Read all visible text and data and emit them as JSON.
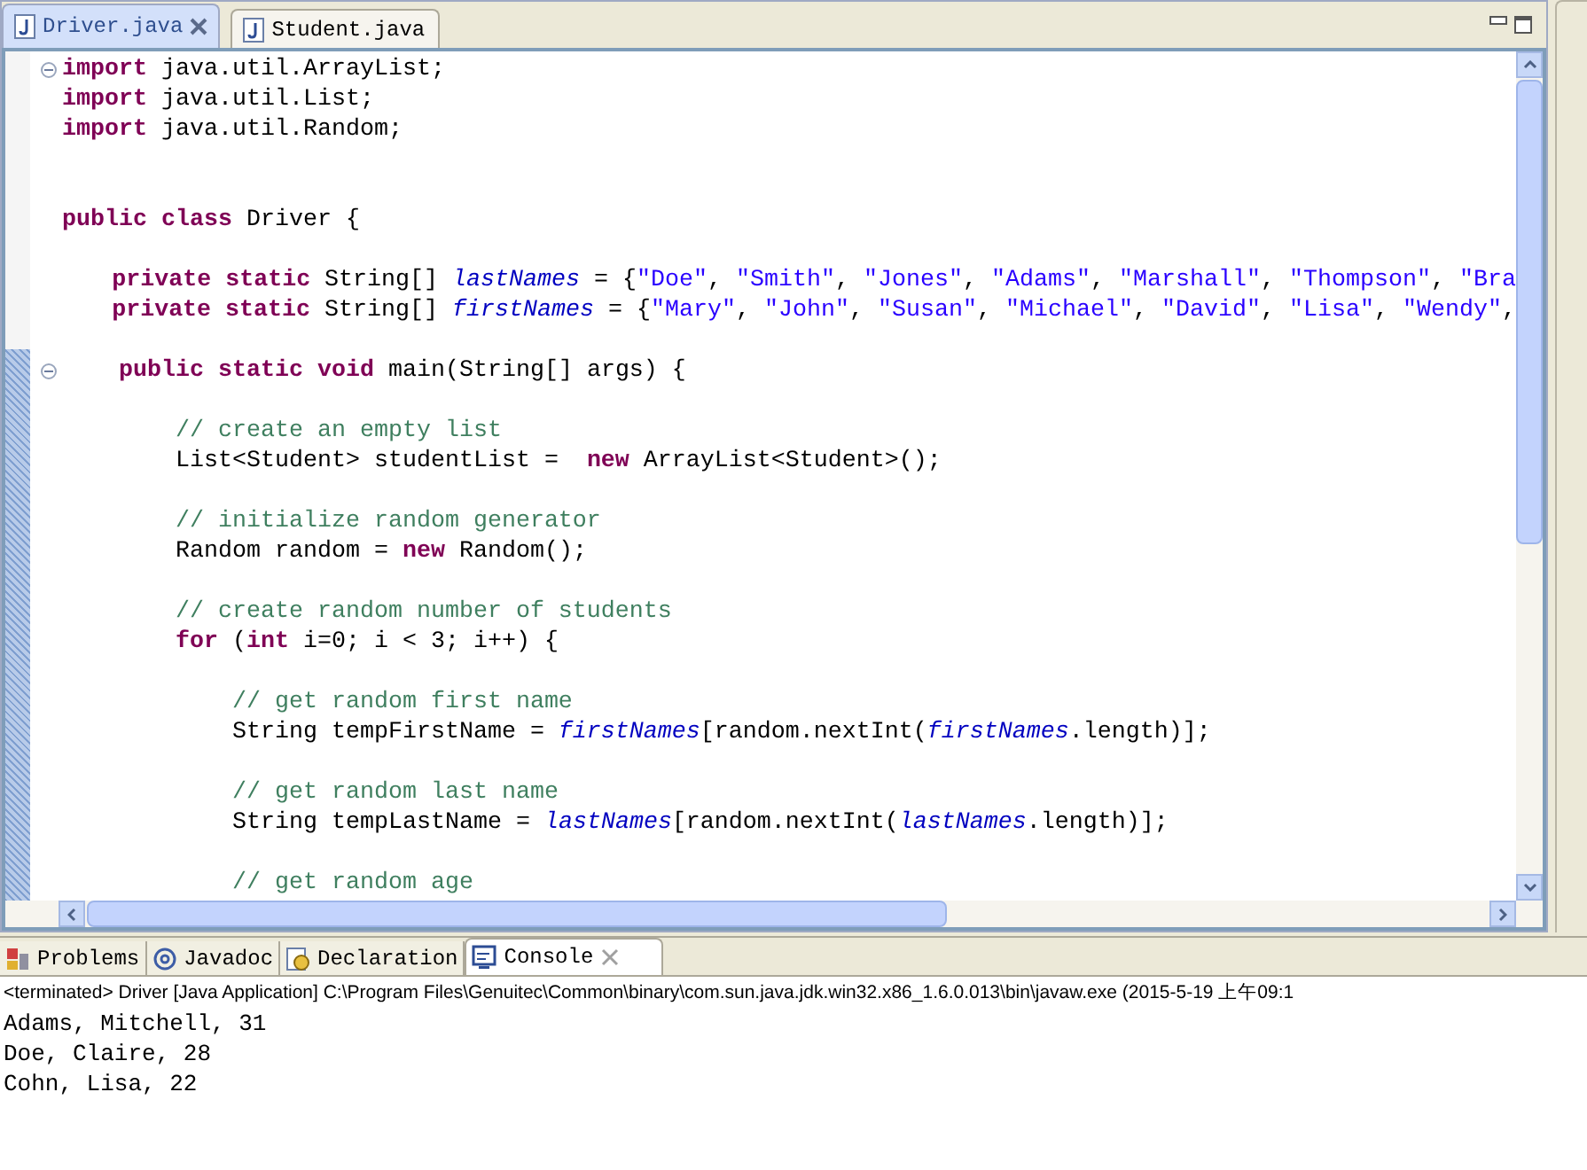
{
  "editor_tabs": [
    {
      "label": "Driver.java",
      "selected": true,
      "closable": true
    },
    {
      "label": "Student.java",
      "selected": false,
      "closable": false
    }
  ],
  "code_lines": [
    {
      "fold": true,
      "tokens": [
        {
          "kind": "keyword",
          "text": "import"
        },
        {
          "kind": "plain",
          "text": " java.util.ArrayList;"
        }
      ]
    },
    {
      "fold": false,
      "tokens": [
        {
          "kind": "keyword",
          "text": "import"
        },
        {
          "kind": "plain",
          "text": " java.util.List;"
        }
      ]
    },
    {
      "fold": false,
      "tokens": [
        {
          "kind": "keyword",
          "text": "import"
        },
        {
          "kind": "plain",
          "text": " java.util.Random;"
        }
      ]
    },
    {
      "fold": false
    },
    {
      "fold": false
    },
    {
      "fold": false,
      "tokens": [
        {
          "kind": "keyword",
          "text": "public class"
        },
        {
          "kind": "plain",
          "text": " Driver {"
        }
      ]
    },
    {
      "fold": false
    },
    {
      "fold": false,
      "tokens": [
        {
          "kind": "keyword",
          "text": "    private static"
        },
        {
          "kind": "plain",
          "text": " String[] "
        },
        {
          "kind": "field",
          "text": "lastNames"
        },
        {
          "kind": "plain",
          "text": " = {"
        },
        {
          "kind": "string",
          "text": "\"Doe\""
        },
        {
          "kind": "plain",
          "text": ", "
        },
        {
          "kind": "string",
          "text": "\"Smith\""
        },
        {
          "kind": "plain",
          "text": ", "
        },
        {
          "kind": "string",
          "text": "\"Jones\""
        },
        {
          "kind": "plain",
          "text": ", "
        },
        {
          "kind": "string",
          "text": "\"Adams\""
        },
        {
          "kind": "plain",
          "text": ", "
        },
        {
          "kind": "string",
          "text": "\"Marshall\""
        },
        {
          "kind": "plain",
          "text": ", "
        },
        {
          "kind": "string",
          "text": "\"Thompson\""
        },
        {
          "kind": "plain",
          "text": ", "
        },
        {
          "kind": "string",
          "text": "\"Bra"
        }
      ]
    },
    {
      "fold": false,
      "tokens": [
        {
          "kind": "keyword",
          "text": "    private static"
        },
        {
          "kind": "plain",
          "text": " String[] "
        },
        {
          "kind": "field",
          "text": "firstNames"
        },
        {
          "kind": "plain",
          "text": " = {"
        },
        {
          "kind": "string",
          "text": "\"Mary\""
        },
        {
          "kind": "plain",
          "text": ", "
        },
        {
          "kind": "string",
          "text": "\"John\""
        },
        {
          "kind": "plain",
          "text": ", "
        },
        {
          "kind": "string",
          "text": "\"Susan\""
        },
        {
          "kind": "plain",
          "text": ", "
        },
        {
          "kind": "string",
          "text": "\"Michael\""
        },
        {
          "kind": "plain",
          "text": ", "
        },
        {
          "kind": "string",
          "text": "\"David\""
        },
        {
          "kind": "plain",
          "text": ", "
        },
        {
          "kind": "string",
          "text": "\"Lisa\""
        },
        {
          "kind": "plain",
          "text": ", "
        },
        {
          "kind": "string",
          "text": "\"Wendy\""
        },
        {
          "kind": "plain",
          "text": ","
        }
      ]
    },
    {
      "fold": false
    },
    {
      "fold": true,
      "tokens": [
        {
          "kind": "keyword",
          "text": "    public static void"
        },
        {
          "kind": "plain",
          "text": " main(String[] args) {"
        }
      ]
    },
    {
      "fold": false
    },
    {
      "fold": false,
      "tokens": [
        {
          "kind": "comment",
          "text": "        // create an empty list"
        }
      ]
    },
    {
      "fold": false,
      "tokens": [
        {
          "kind": "plain",
          "text": "        List<Student> studentList =  "
        },
        {
          "kind": "keyword",
          "text": "new"
        },
        {
          "kind": "plain",
          "text": " ArrayList<Student>();"
        }
      ]
    },
    {
      "fold": false
    },
    {
      "fold": false,
      "tokens": [
        {
          "kind": "comment",
          "text": "        // initialize random generator"
        }
      ]
    },
    {
      "fold": false,
      "tokens": [
        {
          "kind": "plain",
          "text": "        Random random = "
        },
        {
          "kind": "keyword",
          "text": "new"
        },
        {
          "kind": "plain",
          "text": " Random();"
        }
      ]
    },
    {
      "fold": false
    },
    {
      "fold": false,
      "tokens": [
        {
          "kind": "comment",
          "text": "        // create random number of students"
        }
      ]
    },
    {
      "fold": false,
      "tokens": [
        {
          "kind": "keyword",
          "text": "        for"
        },
        {
          "kind": "plain",
          "text": " ("
        },
        {
          "kind": "keyword",
          "text": "int"
        },
        {
          "kind": "plain",
          "text": " i=0; i < 3; i++) {"
        }
      ]
    },
    {
      "fold": false
    },
    {
      "fold": false,
      "tokens": [
        {
          "kind": "comment",
          "text": "            // get random first name"
        }
      ]
    },
    {
      "fold": false,
      "tokens": [
        {
          "kind": "plain",
          "text": "            String tempFirstName = "
        },
        {
          "kind": "field",
          "text": "firstNames"
        },
        {
          "kind": "plain",
          "text": "[random.nextInt("
        },
        {
          "kind": "field",
          "text": "firstNames"
        },
        {
          "kind": "plain",
          "text": ".length)];"
        }
      ]
    },
    {
      "fold": false
    },
    {
      "fold": false,
      "tokens": [
        {
          "kind": "comment",
          "text": "            // get random last name"
        }
      ]
    },
    {
      "fold": false,
      "tokens": [
        {
          "kind": "plain",
          "text": "            String tempLastName = "
        },
        {
          "kind": "field",
          "text": "lastNames"
        },
        {
          "kind": "plain",
          "text": "[random.nextInt("
        },
        {
          "kind": "field",
          "text": "lastNames"
        },
        {
          "kind": "plain",
          "text": ".length)];"
        }
      ]
    },
    {
      "fold": false
    },
    {
      "fold": false,
      "tokens": [
        {
          "kind": "comment",
          "text": "            // get random age"
        }
      ]
    }
  ],
  "bottom_tabs": [
    {
      "label": "Problems",
      "kind": "problems",
      "selected": false,
      "closable": false
    },
    {
      "label": "Javadoc",
      "kind": "javadoc",
      "selected": false,
      "closable": false
    },
    {
      "label": "Declaration",
      "kind": "declaration",
      "selected": false,
      "closable": false
    },
    {
      "label": "Console",
      "kind": "console",
      "selected": true,
      "closable": true
    }
  ],
  "console": {
    "header": "<terminated> Driver [Java Application] C:\\Program Files\\Genuitec\\Common\\binary\\com.sun.java.jdk.win32.x86_1.6.0.013\\bin\\javaw.exe (2015-5-19 上午09:1",
    "lines": [
      "Adams, Mitchell, 31",
      "Doe, Claire, 28",
      "Cohn, Lisa, 22"
    ]
  }
}
